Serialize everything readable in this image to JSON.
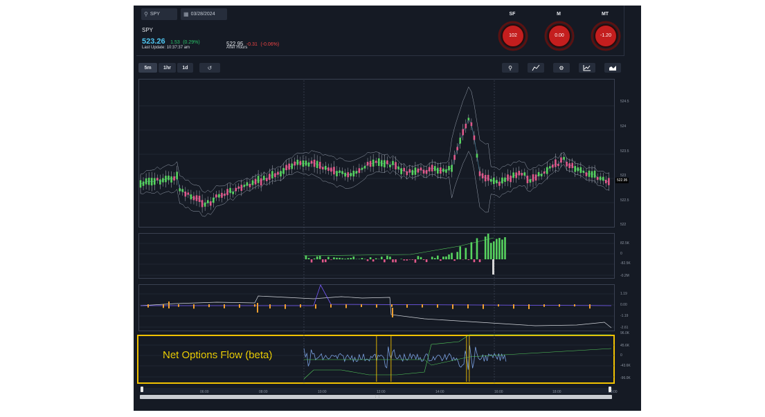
{
  "search": {
    "value": "SPY"
  },
  "date_picker": {
    "value": "03/28/2024"
  },
  "quote": {
    "symbol": "SPY",
    "price": "523.26",
    "change": "1.53",
    "change_pct": "(0.29%)",
    "last_update": "Last Update: 10:37:37 am",
    "ah_price": "522.95",
    "ah_change": "-0.31",
    "ah_change_pct": "(-0.06%)",
    "ah_label": "After Hours"
  },
  "gauges": [
    {
      "label": "SF",
      "value": "102"
    },
    {
      "label": "M",
      "value": "0.00"
    },
    {
      "label": "MT",
      "value": "-1.20"
    }
  ],
  "timeframes": [
    "5m",
    "1hr",
    "1d"
  ],
  "active_timeframe": "5m",
  "toolbar_icons": [
    "history-icon",
    "zoom-icon",
    "indicator-icon",
    "settings-icon",
    "line-chart-icon",
    "area-chart-icon"
  ],
  "price_axis": {
    "ticks": [
      "524.5",
      "524",
      "523.5",
      "523",
      "522.5",
      "522"
    ],
    "last_price_tag": "522.95"
  },
  "volume_axis": {
    "ticks": [
      "82.5K",
      "0",
      "-82.5K",
      "-0.2M"
    ]
  },
  "flow_axis": {
    "ticks": [
      "1.19",
      "0.00",
      "-1.19",
      "-2.61"
    ]
  },
  "net_flow": {
    "title": "Net Options Flow (beta)",
    "ticks": [
      "96.0K",
      "45.6K",
      "0",
      "-43.6K",
      "-96.0K"
    ]
  },
  "time_axis": {
    "labels": [
      "06:00",
      "08:00",
      "10:00",
      "12:00",
      "14:00",
      "16:00",
      "18:00",
      "20:00"
    ]
  },
  "colors": {
    "bg": "#151a24",
    "up": "#57d35f",
    "down": "#e0588a",
    "accent": "#4fc6f1",
    "highlight": "#f2c200",
    "gauge_red": "#d32020"
  }
}
